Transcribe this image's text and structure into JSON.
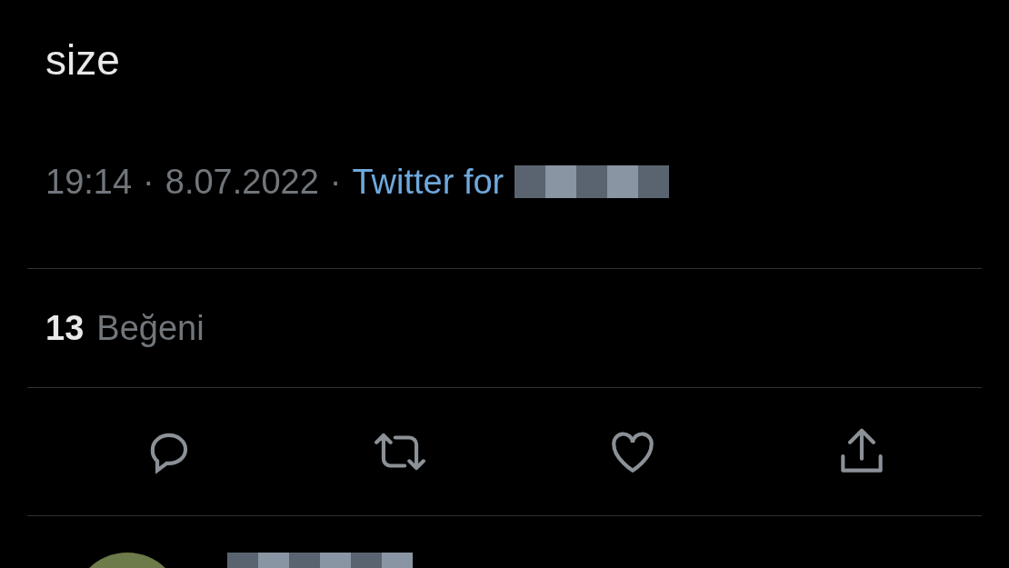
{
  "tweet": {
    "text": "size",
    "time": "19:14",
    "time_separator": "·",
    "date": "8.07.2022",
    "source_separator": "·",
    "source": "Twitter for"
  },
  "stats": {
    "count": "13",
    "label": "Beğeni"
  },
  "actions": [
    {
      "kind": "reply"
    },
    {
      "kind": "retweet"
    },
    {
      "kind": "like"
    },
    {
      "kind": "share"
    }
  ]
}
